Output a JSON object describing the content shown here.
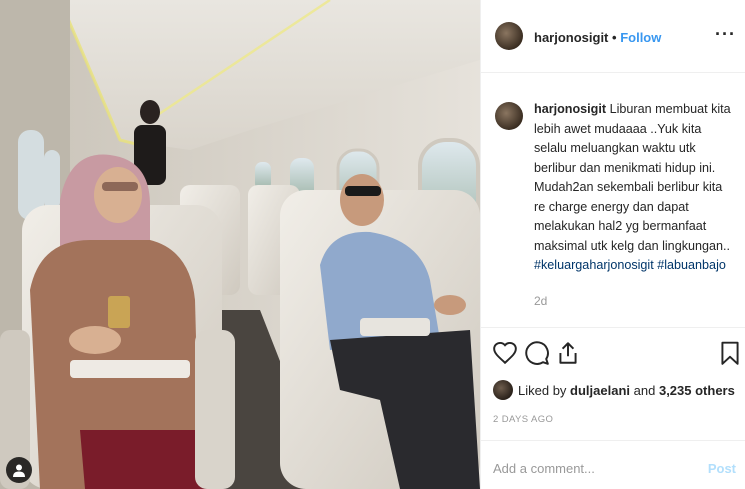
{
  "header": {
    "username": "harjonosigit",
    "separator": "•",
    "follow_label": "Follow",
    "more_label": "···"
  },
  "caption": {
    "username": "harjonosigit",
    "text": "Liburan membuat kita lebih awet mudaaaa ..Yuk kita selalu meluangkan waktu utk berlibur dan menikmati hidup ini. Mudah2an sekembali berlibur kita re charge energy dan dapat melakukan hal2 yg bermanfaat maksimal utk kelg dan lingkungan..",
    "hashtags": [
      "#keluargaharjonosigit",
      "#labuanbajo"
    ],
    "time_ago": "2d"
  },
  "actions": {
    "like_icon": "heart-icon",
    "comment_icon": "comment-icon",
    "share_icon": "share-icon",
    "save_icon": "bookmark-icon"
  },
  "likes": {
    "prefix": "Liked by",
    "liker": "duljaelani",
    "middle": "and",
    "others": "3,235 others"
  },
  "post_date": "2 DAYS AGO",
  "comment_box": {
    "placeholder": "Add a comment...",
    "post_label": "Post"
  },
  "colors": {
    "link_blue": "#3897f0",
    "hashtag": "#003569",
    "muted": "#999999",
    "post_disabled": "#b2dffc"
  }
}
